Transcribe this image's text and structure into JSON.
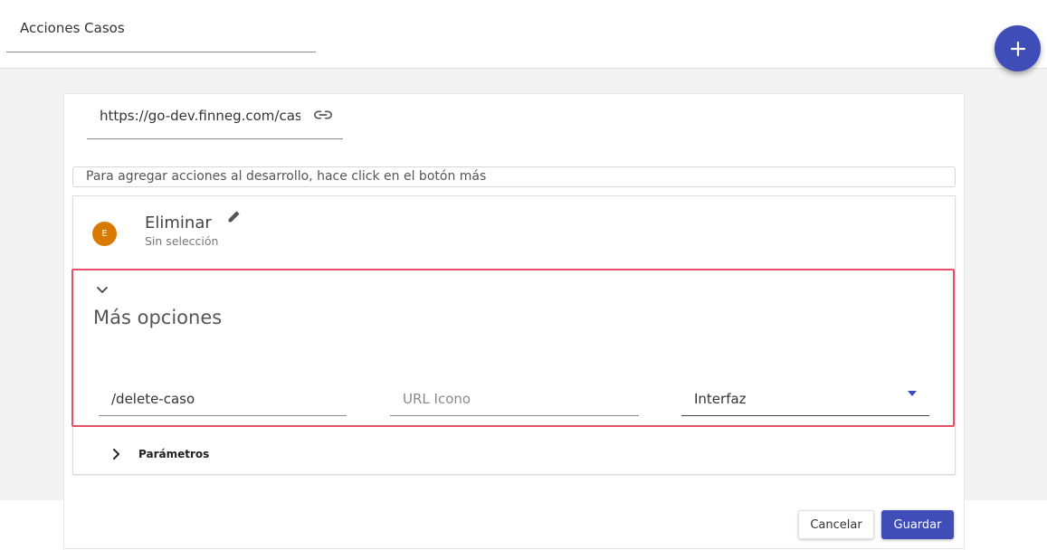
{
  "header": {
    "title": "Acciones Casos",
    "add_icon": "plus-icon"
  },
  "form": {
    "url_value": "https://go-dev.finneg.com/casos",
    "url_icon": "link-icon",
    "info_text": "Para agregar acciones al desarrollo, hace click en el botón más"
  },
  "action": {
    "avatar_letter": "E",
    "avatar_color": "#d97a00",
    "name": "Eliminar",
    "subtitle": "Sin selección",
    "edit_icon": "pencil-icon"
  },
  "more_options": {
    "title": "Más opciones",
    "endpoint_value": "/delete-caso",
    "icon_url_placeholder": "URL Icono",
    "type_selected": "Interfaz"
  },
  "parameters": {
    "label": "Parámetros"
  },
  "footer": {
    "cancel_label": "Cancelar",
    "save_label": "Guardar"
  },
  "colors": {
    "primary": "#3f4db8",
    "highlight": "#e8506a"
  }
}
